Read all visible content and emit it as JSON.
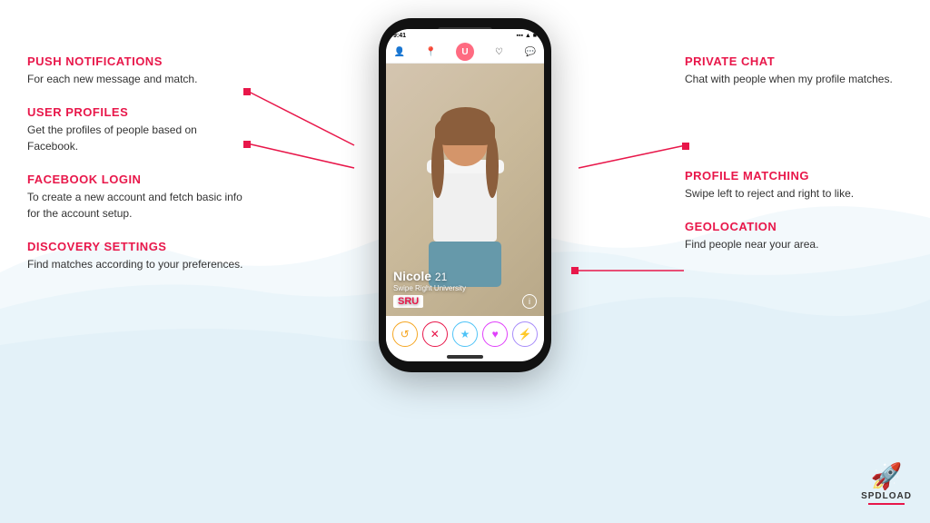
{
  "features": {
    "push_notifications": {
      "title": "PUSH NOTIFICATIONS",
      "desc": "For each new message and match."
    },
    "user_profiles": {
      "title": "USER PROFILES",
      "desc": "Get the profiles of people based on Facebook."
    },
    "facebook_login": {
      "title": "FACEBOOK LOGIN",
      "desc": "To create a new account and fetch basic info for the account setup."
    },
    "discovery_settings": {
      "title": "DISCOVERY SETTINGS",
      "desc": "Find matches according to your preferences."
    },
    "private_chat": {
      "title": "PRIVATE CHAT",
      "desc": "Chat with people when my profile matches."
    },
    "profile_matching": {
      "title": "PROFILE MATCHING",
      "desc": "Swipe left to reject and right to like."
    },
    "geolocation": {
      "title": "GEOLOCATION",
      "desc": "Find people near your area."
    }
  },
  "phone": {
    "status_time": "9:41",
    "profile_name": "Nicole",
    "profile_age": "21",
    "profile_university": "Swipe Right University",
    "profile_sru": "SRU",
    "action_buttons": [
      "↺",
      "✕",
      "★",
      "♥",
      "⚡"
    ]
  },
  "logo": {
    "brand": "SPDLOAD"
  }
}
